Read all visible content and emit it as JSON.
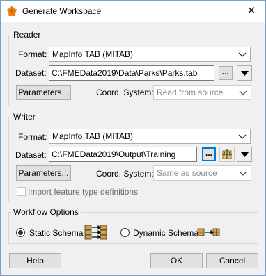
{
  "window": {
    "title": "Generate Workspace",
    "app_icon": "fme-app-icon",
    "close_glyph": "✕"
  },
  "reader": {
    "group_label": "Reader",
    "format_label": "Format:",
    "format_value": "MapInfo TAB (MITAB)",
    "dataset_label": "Dataset:",
    "dataset_value": "C:\\FMEData2019\\Data\\Parks\\Parks.tab",
    "browse_label": "...",
    "parameters_label": "Parameters...",
    "coord_label": "Coord. System:",
    "coord_value": "Read from source"
  },
  "writer": {
    "group_label": "Writer",
    "format_label": "Format:",
    "format_value": "MapInfo TAB (MITAB)",
    "dataset_label": "Dataset:",
    "dataset_value": "C:\\FMEData2019\\Output\\Training",
    "browse_label": "...",
    "parameters_label": "Parameters...",
    "coord_label": "Coord. System:",
    "coord_value": "Same as source",
    "import_label": "Import feature type definitions",
    "import_checked": false
  },
  "workflow": {
    "group_label": "Workflow Options",
    "static_label": "Static Schema",
    "dynamic_label": "Dynamic Schema",
    "selected": "static"
  },
  "footer": {
    "help_label": "Help",
    "ok_label": "OK",
    "cancel_label": "Cancel"
  },
  "colors": {
    "accent": "#0078d7",
    "schema_icon_fill": "#d8a03c"
  }
}
